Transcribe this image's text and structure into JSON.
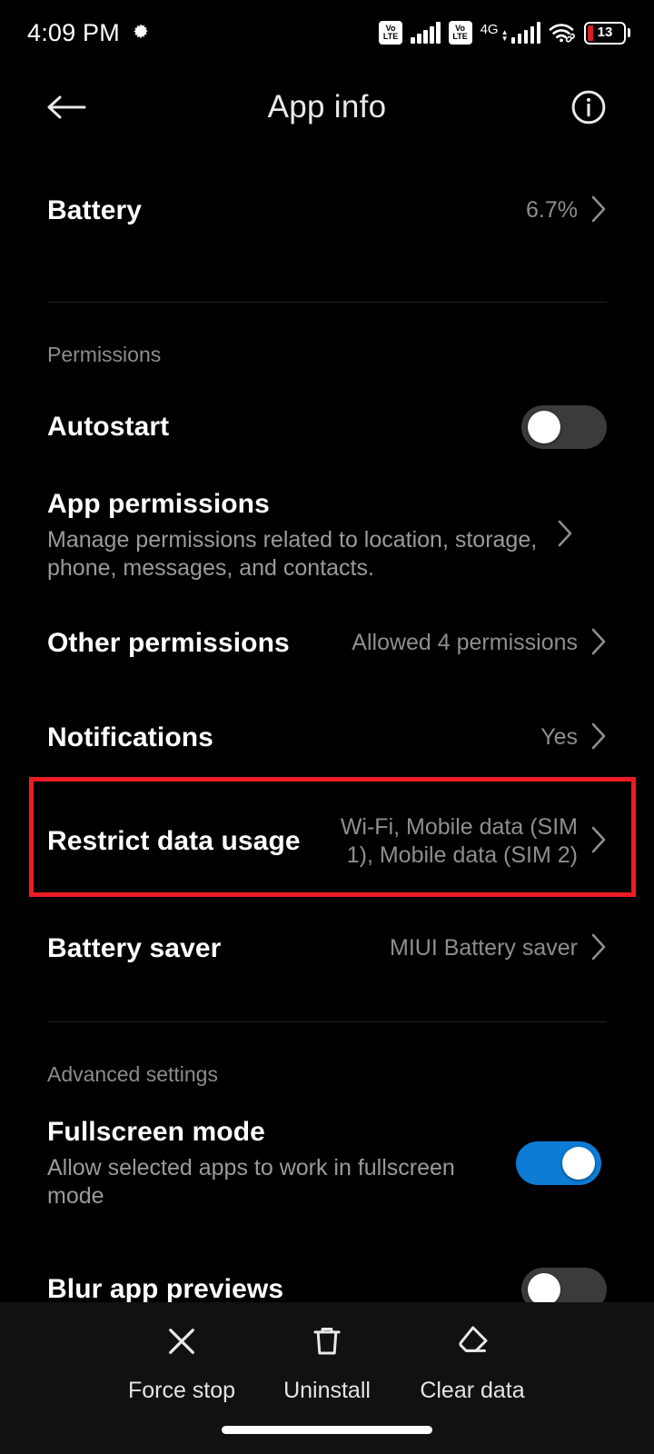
{
  "status_bar": {
    "time": "4:09 PM",
    "gear_icon": "gear-icon",
    "volte_line1": "Vo",
    "volte_line2": "LTE",
    "network_label": "4G",
    "wifi_icon": "wifi-link-icon",
    "battery_percent": "13"
  },
  "app_bar": {
    "back_icon": "back-arrow-icon",
    "title": "App info",
    "info_icon": "info-circle-icon"
  },
  "rows": {
    "battery": {
      "title": "Battery",
      "value": "6.7%"
    },
    "permissions_header": "Permissions",
    "autostart": {
      "title": "Autostart",
      "toggle": "off"
    },
    "app_permissions": {
      "title": "App permissions",
      "subtitle": "Manage permissions related to location, storage, phone, messages, and contacts."
    },
    "other_permissions": {
      "title": "Other permissions",
      "value": "Allowed 4 permissions"
    },
    "notifications": {
      "title": "Notifications",
      "value": "Yes"
    },
    "restrict_data_usage": {
      "title": "Restrict data usage",
      "value": "Wi-Fi, Mobile data (SIM 1), Mobile data (SIM 2)"
    },
    "battery_saver": {
      "title": "Battery saver",
      "value": "MIUI Battery saver"
    },
    "advanced_header": "Advanced settings",
    "fullscreen_mode": {
      "title": "Fullscreen mode",
      "subtitle": "Allow selected apps to work in fullscreen mode",
      "toggle": "on"
    },
    "blur_app_previews": {
      "title": "Blur app previews",
      "toggle": "off"
    }
  },
  "action_bar": {
    "force_stop": {
      "label": "Force stop",
      "icon": "close-x-icon"
    },
    "uninstall": {
      "label": "Uninstall",
      "icon": "trash-icon"
    },
    "clear_data": {
      "label": "Clear data",
      "icon": "eraser-icon"
    }
  },
  "colors": {
    "background": "#000000",
    "highlight": "#ed1c24",
    "toggle_on": "#0c7cd5",
    "toggle_off": "#3b3b3b",
    "secondary_text": "#8e8e8e",
    "action_bar_bg": "#111111"
  }
}
